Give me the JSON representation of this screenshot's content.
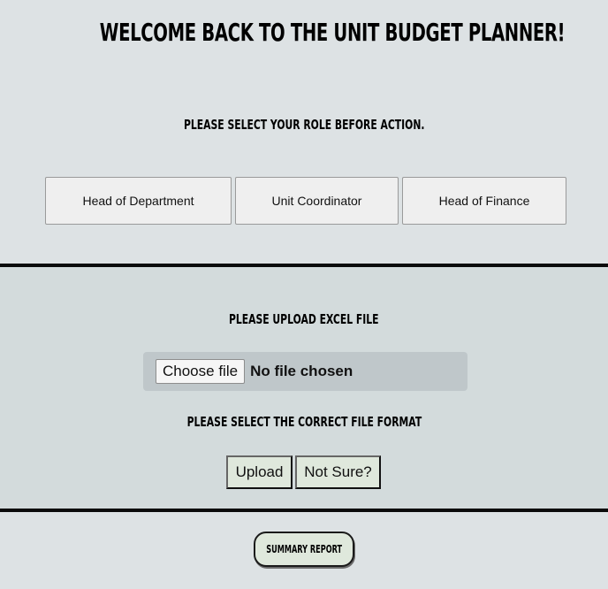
{
  "header": {
    "title": "WELCOME BACK TO THE UNIT BUDGET PLANNER!",
    "subtitle": "PLEASE SELECT YOUR ROLE BEFORE ACTION."
  },
  "roles": [
    {
      "label": "Head of Department"
    },
    {
      "label": "Unit Coordinator"
    },
    {
      "label": "Head of Finance"
    }
  ],
  "upload": {
    "title": "PLEASE UPLOAD EXCEL FILE",
    "choose_label": "Choose file",
    "file_status": "No file chosen",
    "format_prompt": "PLEASE SELECT THE CORRECT FILE FORMAT",
    "upload_label": "Upload",
    "not_sure_label": "Not Sure?"
  },
  "footer": {
    "summary_label": "SUMMARY REPORT"
  }
}
